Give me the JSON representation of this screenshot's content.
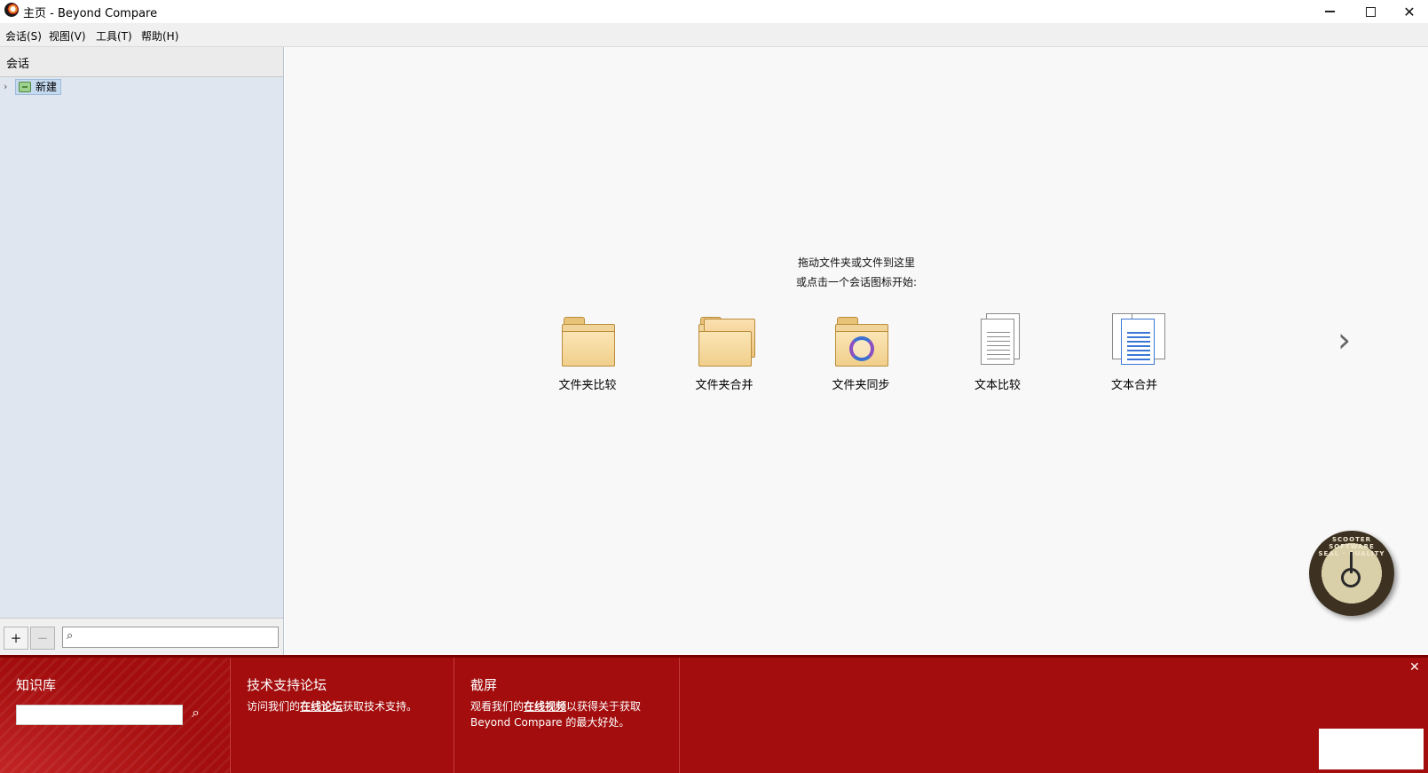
{
  "window": {
    "title": "主页 - Beyond Compare",
    "minimize_label": "",
    "close_label": "✕"
  },
  "menu": [
    {
      "label": "会话(S)"
    },
    {
      "label": "视图(V)"
    },
    {
      "label": "工具(T)"
    },
    {
      "label": "帮助(H)"
    }
  ],
  "sidebar": {
    "header": "会话",
    "tree": [
      {
        "label": "新建",
        "expander": "›"
      }
    ],
    "add_label": "+",
    "remove_label": "−",
    "search_placeholder": "",
    "search_icon": "⌕"
  },
  "main": {
    "prompt_line1": "拖动文件夹或文件到这里",
    "prompt_line2": "或点击一个会话图标开始:",
    "sessions": [
      {
        "label": "文件夹比较",
        "icon": "folder-compare-icon"
      },
      {
        "label": "文件夹合并",
        "icon": "folder-merge-icon"
      },
      {
        "label": "文件夹同步",
        "icon": "folder-sync-icon"
      },
      {
        "label": "文本比较",
        "icon": "text-compare-icon"
      },
      {
        "label": "文本合并",
        "icon": "text-merge-icon"
      }
    ],
    "next_label": "›",
    "seal_text": "SCOOTER SOFTWARE SEAL · QUALITY"
  },
  "info": {
    "kb_title": "知识库",
    "kb_search_icon": "⌕",
    "forum_title": "技术支持论坛",
    "forum_pre": "访问我们的",
    "forum_link": "在线论坛",
    "forum_post": "获取技术支持。",
    "shot_title": "截屏",
    "shot_pre": "观看我们的",
    "shot_link": "在线视频",
    "shot_post": "以获得关于获取",
    "shot_line2": "Beyond Compare 的最大好处。",
    "close_label": "✕"
  },
  "colors": {
    "accent_red": "#a30d0d",
    "sidebar_bg": "#dfe6ef",
    "main_bg": "#f8f8f8"
  }
}
